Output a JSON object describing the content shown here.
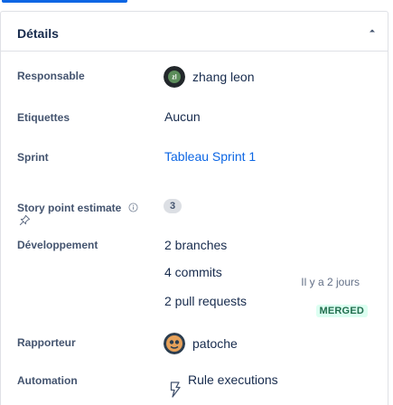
{
  "panel": {
    "title": "Détails"
  },
  "fields": {
    "assignee": {
      "label": "Responsable",
      "value": "zhang leon"
    },
    "labels": {
      "label": "Etiquettes",
      "value": "Aucun"
    },
    "sprint": {
      "label": "Sprint",
      "value": "Tableau Sprint 1"
    },
    "story_points": {
      "label": "Story point estimate",
      "value": "3"
    },
    "development": {
      "label": "Développement",
      "branches": "2 branches",
      "commits": "4 commits",
      "commits_time": "Il y a 2 jours",
      "pull_requests": "2 pull requests",
      "pr_status": "MERGED"
    },
    "reporter": {
      "label": "Rapporteur",
      "value": "patoche"
    },
    "automation": {
      "label": "Automation",
      "value": "Rule executions"
    }
  },
  "colors": {
    "accent": "#0c66e4",
    "merged_text": "#216e4e",
    "merged_bg": "#dcfff1"
  },
  "icons": {
    "collapse": "chevron-up-icon",
    "info": "info-icon",
    "pin": "pin-icon",
    "automation": "lightning-bolt-icon"
  }
}
